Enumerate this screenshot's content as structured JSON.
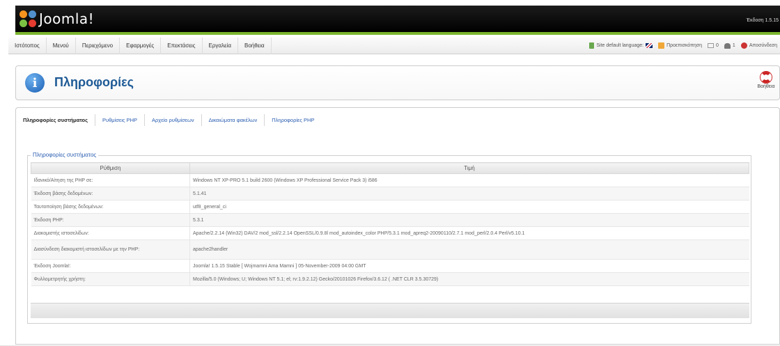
{
  "header": {
    "logo_text": "Joomla!",
    "version": "Έκδοση 1.5.15"
  },
  "menu": {
    "items": [
      "Ιστότοπος",
      "Μενού",
      "Περιεχόμενο",
      "Εφαρμογές",
      "Επεκτάσεις",
      "Εργαλεία",
      "Βοήθεια"
    ]
  },
  "status": {
    "language": "Site default language:",
    "preview": "Προεπισκόπηση",
    "messages": "0",
    "users": "1",
    "logout": "Αποσύνδεση"
  },
  "title": {
    "text": "Πληροφορίες",
    "help_label": "Βοήθεια"
  },
  "tabs": [
    "Πληροφορίες συστήματος",
    "Ρυθμίσεις PHP",
    "Αρχείο ρυθμίσεων",
    "Δικαιώματα φακέλων",
    "Πληροφορίες PHP"
  ],
  "system_info": {
    "legend": "Πληροφορίες συστήματος",
    "headers": [
      "Ρύθμιση",
      "Τιμή"
    ],
    "rows": [
      [
        "Ιδανικό/Αίτηση της PHP σε:",
        "Windows NT XP-PRO 5.1 build 2600 (Windows XP Professional Service Pack 3) i586"
      ],
      [
        "Έκδοση βάσης δεδομένων:",
        "5.1.41"
      ],
      [
        "Ταυτοποίηση βάσης δεδομένων:",
        "utf8_general_ci"
      ],
      [
        "Έκδοση PHP:",
        "5.3.1"
      ],
      [
        "Διακομιστής ιστοσελίδων:",
        "Apache/2.2.14 (Win32) DAV/2 mod_ssl/2.2.14 OpenSSL/0.9.8l mod_autoindex_color PHP/5.3.1 mod_apreq2-20090110/2.7.1 mod_perl/2.0.4 Perl/v5.10.1"
      ],
      [
        "Διασύνδεση διακομιστή ιστοσελίδων με την PHP:",
        "apache2handler"
      ],
      [
        "Έκδοση Joomla!:",
        "Joomla! 1.5.15 Stable [ Wojmamni Ama Mamni ] 05-November-2009 04:00 GMT"
      ],
      [
        "Φυλλομετρητής χρήστη:",
        "Mozilla/5.0 (Windows; U; Windows NT 5.1; el; rv:1.9.2.12) Gecko/20101026 Firefox/3.6.12 ( .NET CLR 3.5.30729)"
      ]
    ]
  }
}
